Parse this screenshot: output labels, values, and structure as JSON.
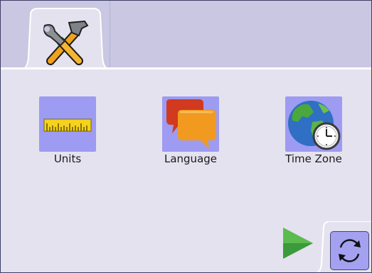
{
  "tabs": [
    {
      "id": "tools",
      "icon": "tools-icon",
      "selected": true
    }
  ],
  "apps": [
    {
      "label": "Units",
      "icon": "ruler-icon"
    },
    {
      "label": "Language",
      "icon": "speech-bubbles-icon"
    },
    {
      "label": "Time Zone",
      "icon": "globe-clock-icon"
    }
  ],
  "navigation": {
    "next_icon": "play-arrow-icon",
    "refresh_icon": "refresh-icon"
  },
  "colors": {
    "tab_strip": "#c9c7e2",
    "content_background": "#e4e2ee",
    "tile_background": "#9d9bf2",
    "next_arrow": "#3b9a3b",
    "refresh_button": "#a3a1f0"
  }
}
